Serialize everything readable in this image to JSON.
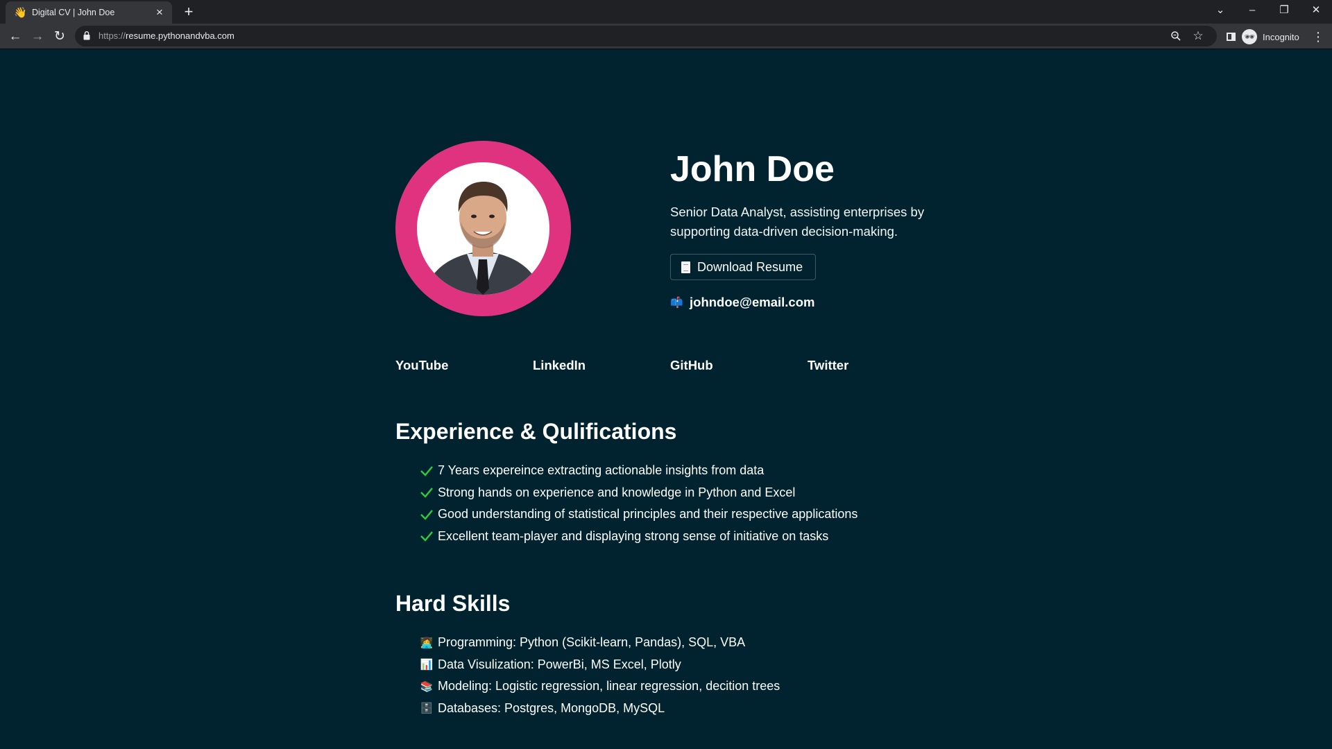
{
  "browser": {
    "tab_title": "Digital CV | John Doe",
    "tab_favicon": "👋",
    "url_scheme": "https://",
    "url_host": "resume.pythonandvba.com",
    "profile_label": "Incognito"
  },
  "profile": {
    "name": "John Doe",
    "tagline": "Senior Data Analyst, assisting enterprises by supporting data-driven decision-making.",
    "download_icon": "📄",
    "download_label": "Download Resume",
    "email_icon": "📫",
    "email": "johndoe@email.com",
    "avatar_ring_color": "#e0337f"
  },
  "social_links": [
    "YouTube",
    "LinkedIn",
    "GitHub",
    "Twitter"
  ],
  "experience": {
    "title": "Experience & Qulifications",
    "items": [
      "7 Years expereince extracting actionable insights from data",
      "Strong hands on experience and knowledge in Python and Excel",
      "Good understanding of statistical principles and their respective applications",
      "Excellent team-player and displaying strong sense of initiative on tasks"
    ]
  },
  "skills": {
    "title": "Hard Skills",
    "items": [
      {
        "icon": "👩‍💻",
        "text": "Programming: Python (Scikit-learn, Pandas), SQL, VBA"
      },
      {
        "icon": "📊",
        "text": "Data Visulization: PowerBi, MS Excel, Plotly"
      },
      {
        "icon": "📚",
        "text": "Modeling: Logistic regression, linear regression, decition trees"
      },
      {
        "icon": "🗄️",
        "text": "Databases: Postgres, MongoDB, MySQL"
      }
    ]
  },
  "colors": {
    "page_background": "#00232f",
    "check_green": "#2ecc40"
  }
}
